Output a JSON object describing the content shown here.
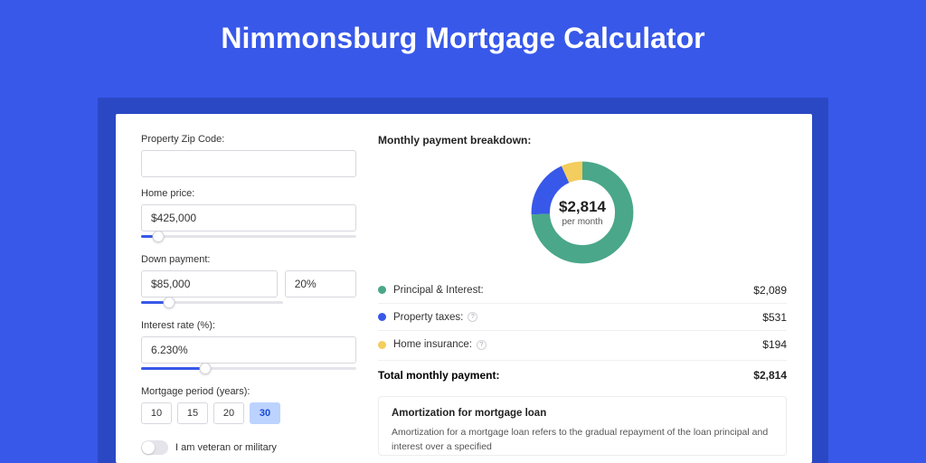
{
  "title": "Nimmonsburg Mortgage Calculator",
  "colors": {
    "principal": "#4aa789",
    "taxes": "#3858e9",
    "insurance": "#f3cd5d"
  },
  "left": {
    "zip_label": "Property Zip Code:",
    "zip_value": "",
    "home_price_label": "Home price:",
    "home_price_value": "$425,000",
    "home_price_slider_pct": 8,
    "down_label": "Down payment:",
    "down_amount": "$85,000",
    "down_pct": "20%",
    "down_slider_pct": 20,
    "rate_label": "Interest rate (%):",
    "rate_value": "6.230%",
    "rate_slider_pct": 30,
    "period_label": "Mortgage period (years):",
    "periods": [
      "10",
      "15",
      "20",
      "30"
    ],
    "period_active": 3,
    "veteran_label": "I am veteran or military"
  },
  "right": {
    "breakdown_title": "Monthly payment breakdown:",
    "donut_amount": "$2,814",
    "donut_sub": "per month",
    "chart_data": {
      "type": "donut",
      "series": [
        {
          "name": "Principal & Interest",
          "value": 2089,
          "color": "#4aa789"
        },
        {
          "name": "Property taxes",
          "value": 531,
          "color": "#3858e9"
        },
        {
          "name": "Home insurance",
          "value": 194,
          "color": "#f3cd5d"
        }
      ],
      "total": 2814
    },
    "legend": [
      {
        "label": "Principal & Interest:",
        "value": "$2,089",
        "info": false
      },
      {
        "label": "Property taxes:",
        "value": "$531",
        "info": true
      },
      {
        "label": "Home insurance:",
        "value": "$194",
        "info": true
      }
    ],
    "total_label": "Total monthly payment:",
    "total_value": "$2,814",
    "amort_title": "Amortization for mortgage loan",
    "amort_text": "Amortization for a mortgage loan refers to the gradual repayment of the loan principal and interest over a specified"
  }
}
